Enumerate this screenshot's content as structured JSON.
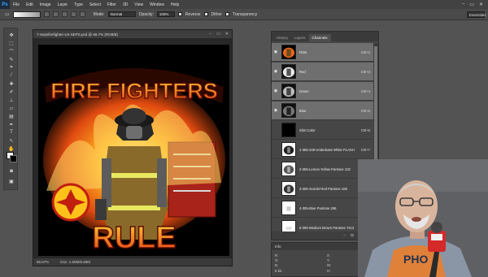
{
  "app": {
    "logo": "Ps"
  },
  "menu": [
    "File",
    "Edit",
    "Image",
    "Layer",
    "Type",
    "Select",
    "Filter",
    "3D",
    "View",
    "Window",
    "Help"
  ],
  "window_controls": [
    "–",
    "▭",
    "✕"
  ],
  "options_bar": {
    "mode_label": "Mode:",
    "mode_value": "Normal",
    "opacity_label": "Opacity:",
    "opacity_value": "100%",
    "reverse_label": "Reverse",
    "dither_label": "Dither",
    "transparency_label": "Transparency",
    "workspace": "Essentials"
  },
  "document": {
    "tab_title": "7-Sepsfirefighter-LN-SEPS.psd @ 66.7% (RGB/8)",
    "zoom": "66.67%",
    "doc_size": "Doc: 1.60M/6.69M"
  },
  "artwork": {
    "headline": "FIRE FIGHTERS",
    "footer_word": "RULE"
  },
  "channels_panel": {
    "tabs": [
      "History",
      "Layers",
      "Channels"
    ],
    "active_tab": "Channels",
    "channels": [
      {
        "name": "RGB",
        "shortcut": "Ctrl+2"
      },
      {
        "name": "Red",
        "shortcut": "Ctrl+3"
      },
      {
        "name": "Green",
        "shortcut": "Ctrl+4"
      },
      {
        "name": "Blue",
        "shortcut": "Ctrl+5"
      },
      {
        "name": "Shirt Color",
        "shortcut": "Ctrl+6"
      },
      {
        "name": "1-355-239-Underbase White PLASH APT...",
        "shortcut": "Ctrl+7"
      },
      {
        "name": "2-305-Lemon Yellow Pantone 102",
        "shortcut": "Ctrl+8"
      },
      {
        "name": "3-305-Scarlet Red Pantone 185",
        "shortcut": "Ctrl+9"
      },
      {
        "name": "4-305-Blue Pantone 286",
        "shortcut": ""
      },
      {
        "name": "5-305-Medium Brown Pantone 7412",
        "shortcut": ""
      }
    ]
  },
  "info_panel": {
    "tab": "Info",
    "cells": [
      "R:",
      "G:",
      "B:",
      "8-bit",
      "X:",
      "Y:",
      "W:",
      "H:"
    ]
  },
  "webcam": {
    "shirt_text": "PHO"
  }
}
